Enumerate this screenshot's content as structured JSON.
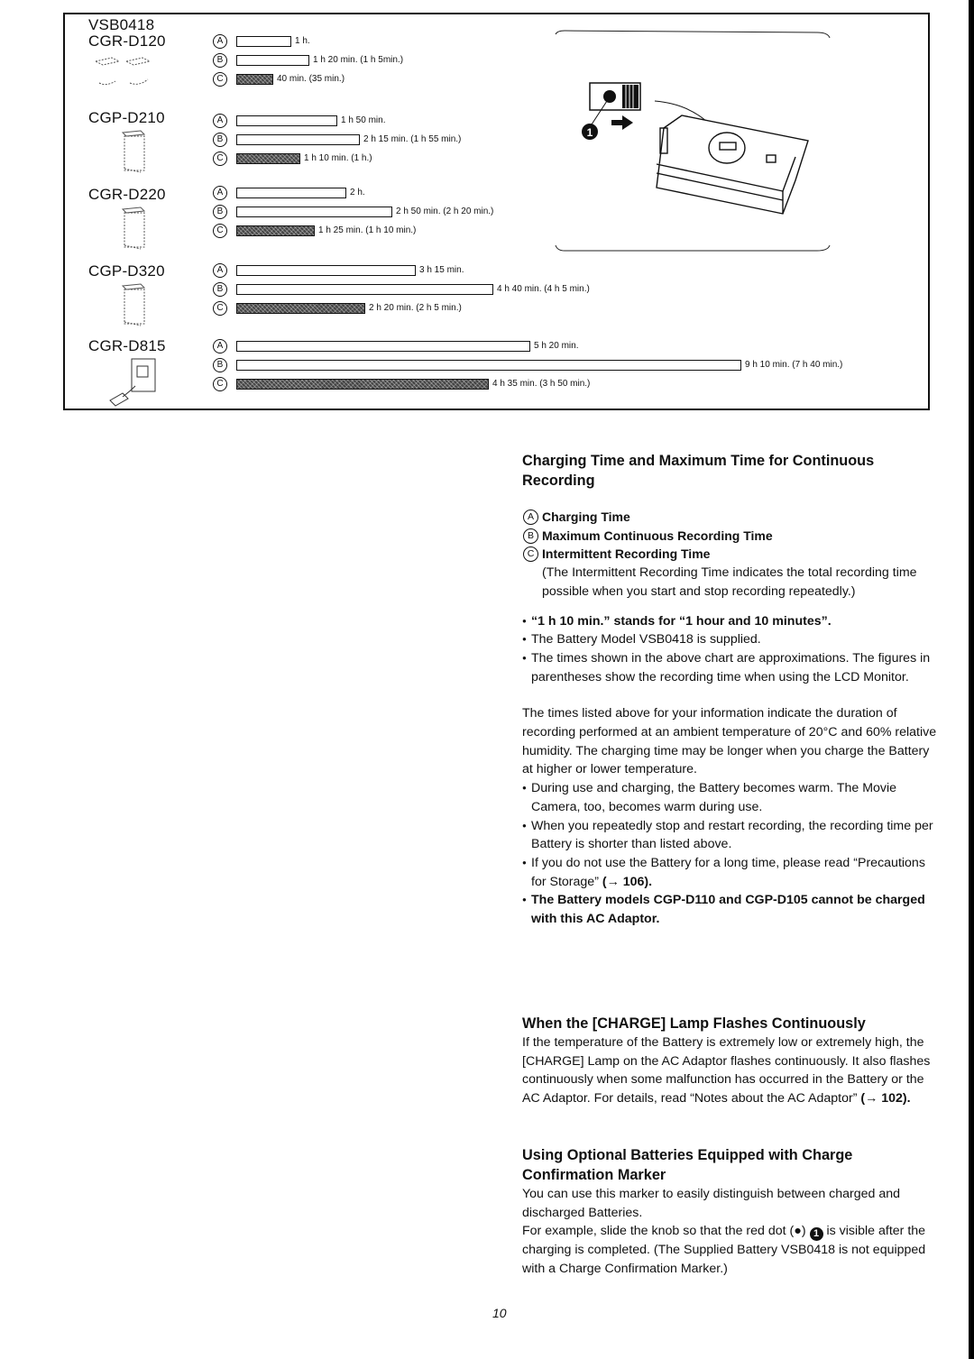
{
  "chart_data": {
    "type": "bar",
    "title": "Charging Time and Maximum Time for Continuous Recording",
    "xlabel": "",
    "ylabel": "",
    "unit": "minutes",
    "legend": [
      {
        "key": "A",
        "label": "Charging Time",
        "style": "outline"
      },
      {
        "key": "B",
        "label": "Maximum Continuous Recording Time",
        "style": "outline"
      },
      {
        "key": "C",
        "label": "Intermittent Recording Time",
        "style": "hatched"
      }
    ],
    "categories": [
      "VSB0418 / CGR-D120",
      "CGP-D210",
      "CGR-D220",
      "CGP-D320",
      "CGR-D815"
    ],
    "series": [
      {
        "name": "A",
        "values": [
          60,
          110,
          120,
          195,
          320
        ],
        "labels": [
          "1 h.",
          "1 h 50 min.",
          "2 h.",
          "3 h 15 min.",
          "5 h 20 min."
        ]
      },
      {
        "name": "B",
        "values": [
          80,
          135,
          170,
          280,
          550
        ],
        "labels": [
          "1 h 20 min. (1 h 5min.)",
          "2 h 15 min. (1 h 55 min.)",
          "2 h 50 min. (2 h 20 min.)",
          "4 h 40 min. (4 h 5 min.)",
          "9 h 10 min. (7 h 40 min.)"
        ]
      },
      {
        "name": "C",
        "values": [
          40,
          70,
          85,
          140,
          275
        ],
        "labels": [
          "40 min. (35 min.)",
          "1 h 10 min. (1 h.)",
          "1 h 25 min. (1 h 10 min.)",
          "2 h 20 min. (2 h 5 min.)",
          "4 h 35 min. (3 h 50 min.)"
        ]
      }
    ],
    "xlim": [
      0,
      550
    ]
  },
  "chart": {
    "groups": [
      {
        "names": [
          "VSB0418",
          "CGR-D120"
        ],
        "icon": "battery-pair-icon"
      },
      {
        "names": [
          "CGP-D210"
        ],
        "icon": "battery-icon"
      },
      {
        "names": [
          "CGR-D220"
        ],
        "icon": "battery-icon"
      },
      {
        "names": [
          "CGP-D320"
        ],
        "icon": "battery-icon"
      },
      {
        "names": [
          "CGR-D815"
        ],
        "icon": "charger-icon"
      }
    ],
    "row_keys": [
      "A",
      "B",
      "C"
    ]
  },
  "illustration": {
    "marker_number": "1",
    "caption_icon": "battery-charge-marker-illustration"
  },
  "section1": {
    "heading": "Charging Time and Maximum Time for Continuous Recording",
    "legend": [
      {
        "key": "A",
        "label": "Charging Time"
      },
      {
        "key": "B",
        "label": "Maximum Continuous Recording Time"
      },
      {
        "key": "C",
        "label": "Intermittent Recording Time"
      }
    ],
    "legend_note": "(The Intermittent Recording Time indicates the total recording time possible when you start and stop recording repeatedly.)",
    "bullets": [
      {
        "text": "“1 h 10 min.” stands for “1 hour and 10 minutes”.",
        "bold": true
      },
      {
        "text": "The Battery Model VSB0418 is supplied.",
        "bold": false
      },
      {
        "text": "The times shown in the above chart are approximations. The figures in parentheses show the recording time when using the LCD Monitor.",
        "bold": false
      }
    ],
    "paragraph": "The times listed above for your information indicate the duration of recording performed at an ambient temperature of 20°C and 60% relative humidity. The charging time may be longer when you charge the Battery at higher or lower temperature.",
    "bullets2": [
      {
        "text": "During use and charging, the Battery becomes warm. The Movie Camera, too, becomes warm during use."
      },
      {
        "text": "When you repeatedly stop and restart recording, the recording time per Battery is shorter than listed above."
      }
    ],
    "storage_bullet": {
      "text": "If you do not use the Battery for a long time, please read “Precautions for Storage” ",
      "ref": "(→ 106)."
    },
    "warning_bullet": "The Battery models CGP-D110 and CGP-D105 cannot be charged with this AC Adaptor."
  },
  "section2": {
    "heading": "When the [CHARGE] Lamp Flashes Continuously",
    "body": "If the temperature of the Battery is extremely low or extremely high, the [CHARGE] Lamp on the AC Adaptor flashes continuously. It also flashes continuously when some malfunction has occurred in the Battery or the AC Adaptor. For details, read “Notes about the AC Adaptor” ",
    "ref": "(→ 102)."
  },
  "section3": {
    "heading": "Using Optional Batteries Equipped with Charge Confirmation Marker",
    "body1": "You can use this marker to easily distinguish between charged and discharged Batteries.",
    "body2_pre": "For example, slide the knob so that the red dot (●) ",
    "marker": "1",
    "body2_post": " is visible after the charging is completed. (The Supplied Battery VSB0418 is not equipped with a Charge Confirmation Marker.)"
  },
  "page_number": "10"
}
